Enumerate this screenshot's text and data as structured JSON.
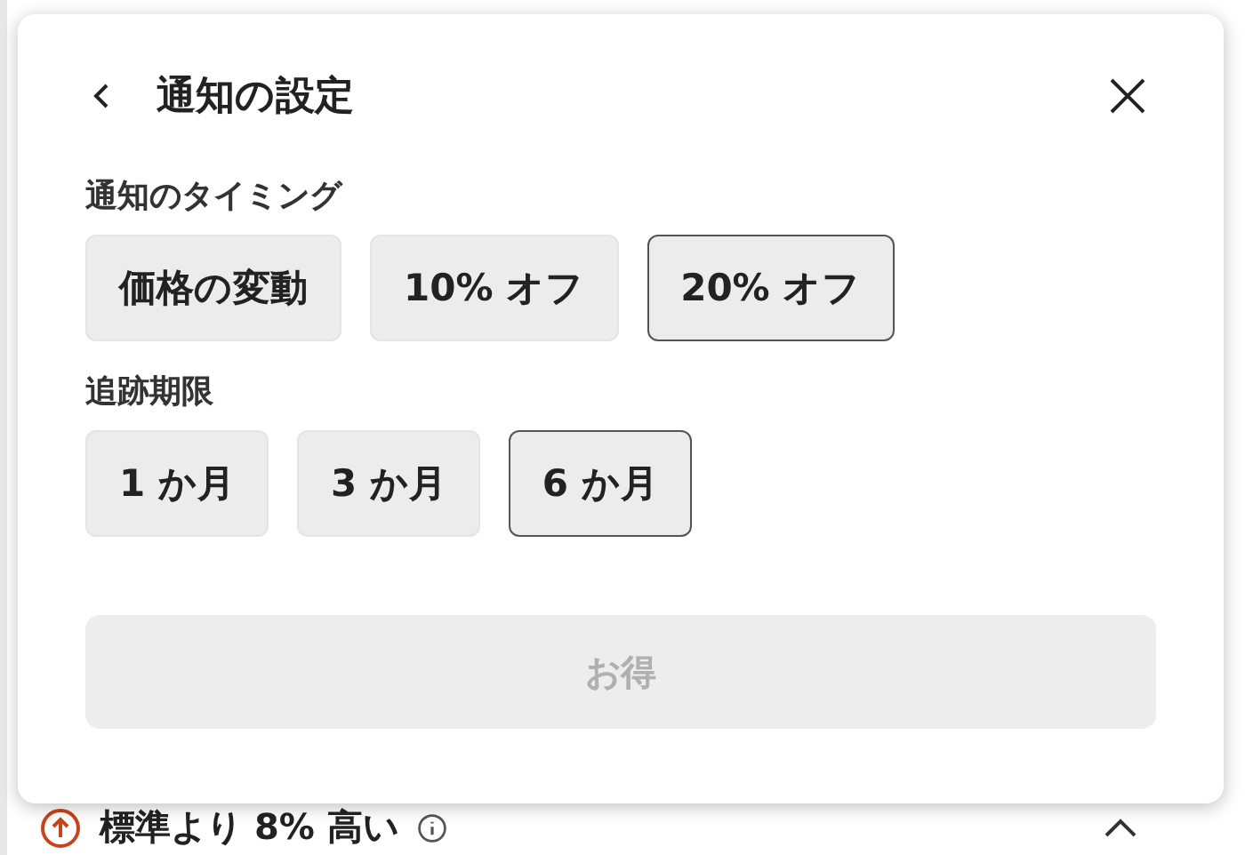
{
  "dialog": {
    "title": "通知の設定",
    "sections": [
      {
        "label": "通知のタイミング",
        "options": [
          {
            "label": "価格の変動",
            "selected": false
          },
          {
            "label": "10% オフ",
            "selected": false
          },
          {
            "label": "20% オフ",
            "selected": true
          }
        ]
      },
      {
        "label": "追跡期限",
        "options": [
          {
            "label": "1 か月",
            "selected": false
          },
          {
            "label": "3 か月",
            "selected": false
          },
          {
            "label": "6 か月",
            "selected": true
          }
        ]
      }
    ],
    "submit": {
      "label": "お得",
      "disabled": true
    }
  },
  "background": {
    "price_note": "標準より 8% 高い"
  }
}
